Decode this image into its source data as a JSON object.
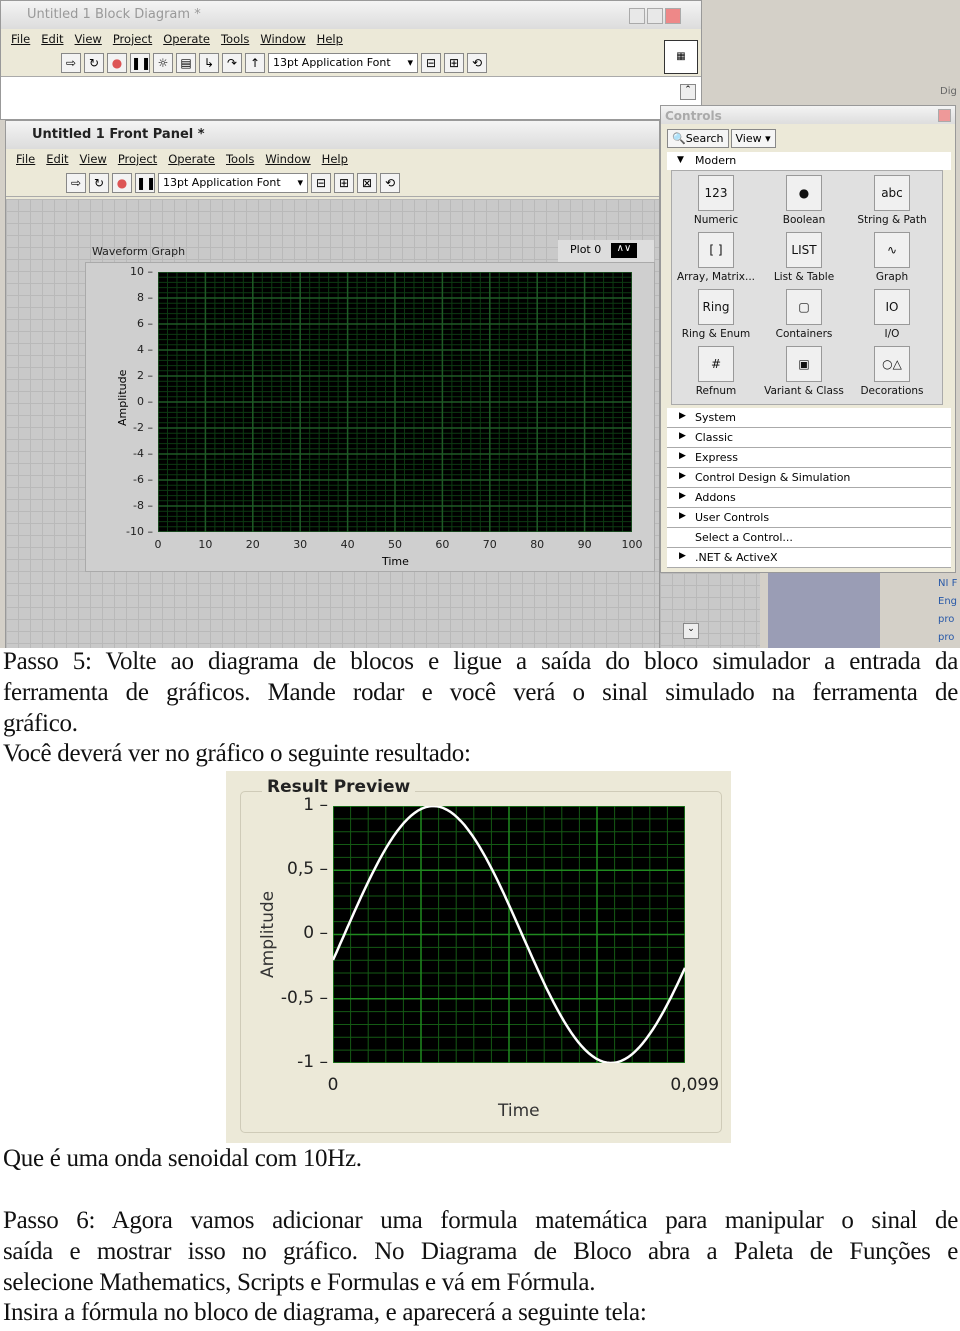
{
  "block_diagram": {
    "title": "Untitled 1 Block Diagram *",
    "menu": [
      "File",
      "Edit",
      "View",
      "Project",
      "Operate",
      "Tools",
      "Window",
      "Help"
    ],
    "font": "13pt Application Font"
  },
  "front_panel": {
    "title": "Untitled 1 Front Panel *",
    "menu": [
      "File",
      "Edit",
      "View",
      "Project",
      "Operate",
      "Tools",
      "Window",
      "Help"
    ],
    "font": "13pt Application Font",
    "graph": {
      "label": "Waveform Graph",
      "legend": "Plot 0",
      "ylabel": "Amplitude",
      "xlabel": "Time"
    }
  },
  "controls_palette": {
    "title": "Controls",
    "search": "Search",
    "view": "View",
    "section": "Modern",
    "items": [
      "Numeric",
      "Boolean",
      "String & Path",
      "Array, Matrix...",
      "List & Table",
      "Graph",
      "Ring & Enum",
      "Containers",
      "I/O",
      "Refnum",
      "Variant & Class",
      "Decorations"
    ],
    "icons": [
      "123",
      "●",
      "abc",
      "[ ]",
      "LIST",
      "∿",
      "Ring",
      "▢",
      "IO",
      "#",
      "▣",
      "○△"
    ],
    "categories": [
      "System",
      "Classic",
      "Express",
      "Control Design & Simulation",
      "Addons",
      "User Controls",
      "Select a Control...",
      ".NET & ActiveX"
    ]
  },
  "side_text": [
    "Dig",
    "NI F",
    "Eng",
    "pro",
    "pro"
  ],
  "text": {
    "p1": [
      "Passo 5: Volte ao diagrama de blocos e ligue a saída do bloco simulador a entrada da",
      "ferramenta de gráficos. Mande rodar e você verá o sinal simulado na ferramenta de",
      "gráfico."
    ],
    "p2": "Você deverá ver no gráfico o seguinte resultado:",
    "p3": "Que é uma onda senoidal com 10Hz.",
    "p4": [
      "Passo 6: Agora vamos adicionar uma formula matemática para manipular o sinal de",
      "saída e mostrar isso no gráfico. No Diagrama de Bloco abra a Paleta de Funções e",
      "selecione Mathematics, Scripts e Formulas e vá em Fórmula."
    ],
    "p5": "Insira a fórmula no bloco de diagrama, e aparecerá a seguinte tela:"
  },
  "chart_data": [
    {
      "type": "line",
      "title": "Waveform Graph",
      "legend": [
        "Plot 0"
      ],
      "xlabel": "Time",
      "ylabel": "Amplitude",
      "xlim": [
        0,
        100
      ],
      "ylim": [
        -10,
        10
      ],
      "xticks": [
        "0",
        "10",
        "20",
        "30",
        "40",
        "50",
        "60",
        "70",
        "80",
        "90",
        "100"
      ],
      "yticks": [
        "10",
        "8",
        "6",
        "4",
        "2",
        "0",
        "-2",
        "-4",
        "-6",
        "-8",
        "-10"
      ],
      "grid": true,
      "series": []
    },
    {
      "type": "line",
      "title": "Result Preview",
      "xlabel": "Time",
      "ylabel": "Amplitude",
      "xlim": [
        0,
        0.099
      ],
      "ylim": [
        -1,
        1
      ],
      "xticks": [
        "0",
        "0,099"
      ],
      "yticks": [
        "1",
        "0,5",
        "0",
        "-0,5",
        "-1"
      ],
      "grid": true,
      "series": [
        {
          "frequency_hz": 10,
          "amplitude": 1,
          "phase_rad": -0.2,
          "x_start": 0,
          "x_end": 0.099,
          "points": 100
        }
      ],
      "colors": {
        "background": "#000000",
        "grid": "#1f7a1f",
        "line": "#ffffff"
      }
    }
  ]
}
